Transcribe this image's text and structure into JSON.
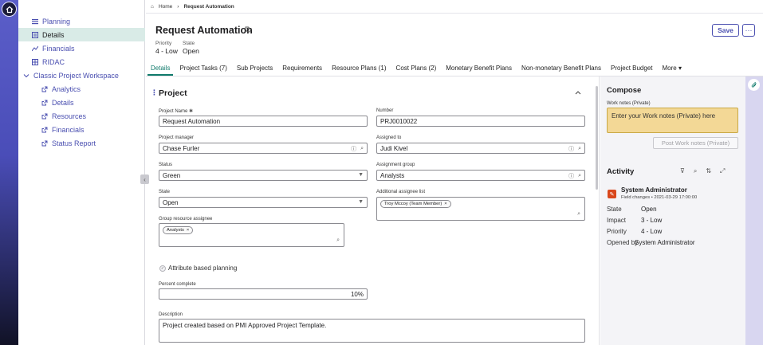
{
  "sidebar": {
    "items": [
      {
        "label": "Planning",
        "icon": "list-icon"
      },
      {
        "label": "Details",
        "icon": "details-icon"
      },
      {
        "label": "Financials",
        "icon": "chart-icon"
      },
      {
        "label": "RIDAC",
        "icon": "grid-icon"
      },
      {
        "label": "Classic Project Workspace",
        "icon": "chevron-down-icon"
      },
      {
        "label": "Analytics",
        "icon": "external-link-icon"
      },
      {
        "label": "Details",
        "icon": "external-link-icon"
      },
      {
        "label": "Resources",
        "icon": "external-link-icon"
      },
      {
        "label": "Financials",
        "icon": "external-link-icon"
      },
      {
        "label": "Status Report",
        "icon": "external-link-icon"
      }
    ]
  },
  "breadcrumb": {
    "home": "Home",
    "current": "Request Automation"
  },
  "header": {
    "title": "Request Automation",
    "priority_label": "Priority",
    "priority_value": "4 - Low",
    "state_label": "State",
    "state_value": "Open",
    "save_label": "Save",
    "more_label": "···"
  },
  "tabs": [
    "Details",
    "Project Tasks (7)",
    "Sub Projects",
    "Requirements",
    "Resource Plans (1)",
    "Cost Plans (2)",
    "Monetary Benefit Plans",
    "Non-monetary Benefit Plans",
    "Project Budget",
    "More ▾"
  ],
  "section": {
    "title": "Project"
  },
  "form": {
    "project_name_label": "Project Name",
    "project_name_value": "Request Automation",
    "number_label": "Number",
    "number_value": "PRJ0010022",
    "project_manager_label": "Project manager",
    "project_manager_value": "Chase Furler",
    "assigned_to_label": "Assigned to",
    "assigned_to_value": "Judi Kivel",
    "status_label": "Status",
    "status_value": "Green",
    "assignment_group_label": "Assignment group",
    "assignment_group_value": "Analysts",
    "state_label": "State",
    "state_value": "Open",
    "additional_assignee_label": "Additional assignee list",
    "additional_assignee_chip": "Troy Mccoy (Team Member)",
    "group_resource_label": "Group resource assignee",
    "group_resource_chip": "Analysts",
    "attribute_planning_label": "Attribute based planning",
    "percent_complete_label": "Percent complete",
    "percent_complete_value": "10%",
    "description_label": "Description",
    "description_value": "Project created based on PMI Approved Project Template."
  },
  "compose": {
    "title": "Compose",
    "work_notes_label": "Work notes (Private)",
    "work_notes_placeholder": "Enter your Work notes (Private) here",
    "post_label": "Post Work notes (Private)"
  },
  "activity": {
    "title": "Activity",
    "author": "System Administrator",
    "subtitle": "Field changes • 2021-03-29 17:00:00",
    "fields": [
      {
        "label": "State",
        "value": "Open"
      },
      {
        "label": "Impact",
        "value": "3 - Low"
      },
      {
        "label": "Priority",
        "value": "4 - Low"
      },
      {
        "label": "Opened by",
        "value": "System Administrator"
      }
    ]
  },
  "colors": {
    "accent": "#4a4fb0",
    "active_tab": "#107a6b",
    "notes_bg": "#f3d896",
    "rail": "#4a4db8"
  }
}
